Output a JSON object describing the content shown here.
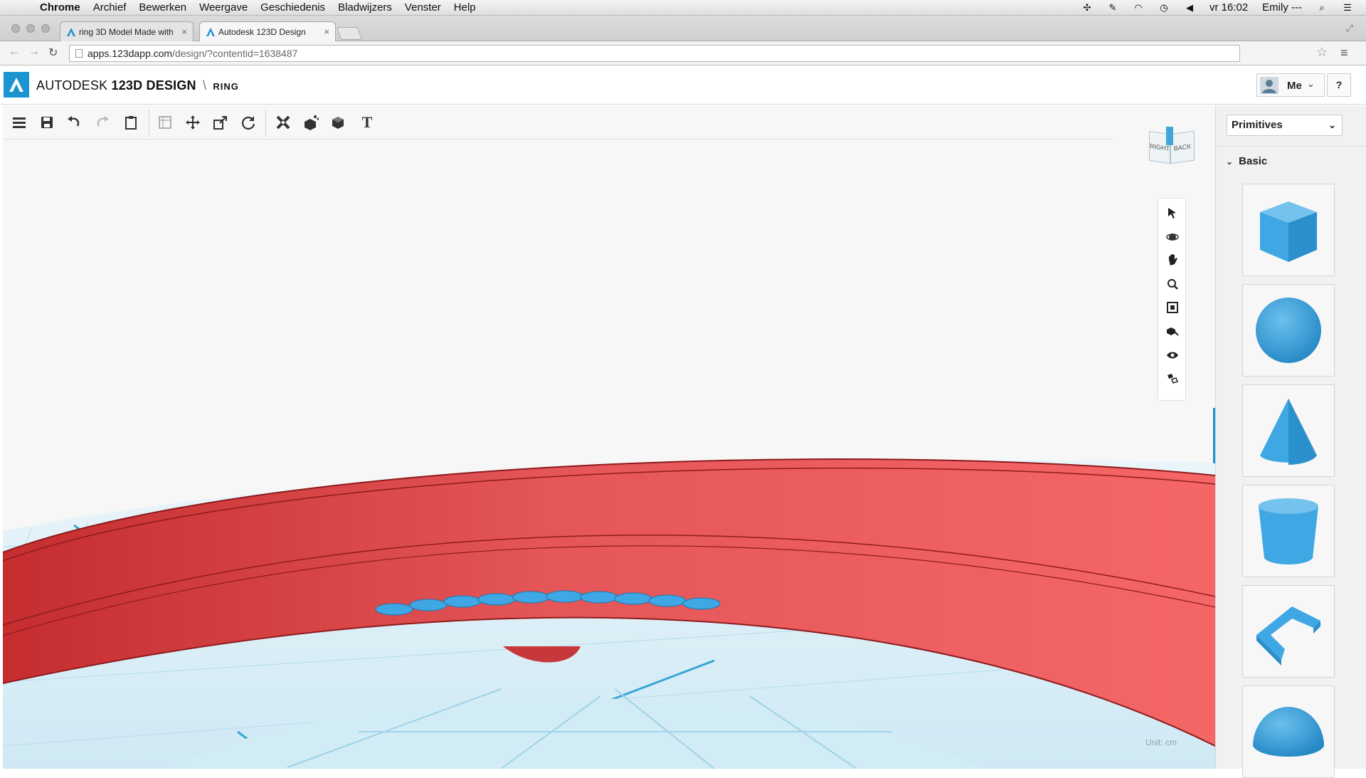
{
  "menubar": {
    "app": "Chrome",
    "items": [
      "Archief",
      "Bewerken",
      "Weergave",
      "Geschiedenis",
      "Bladwijzers",
      "Venster",
      "Help"
    ],
    "clock": "vr 16:02",
    "user": "Emily ---"
  },
  "browser": {
    "tabs": [
      {
        "title": "ring 3D Model Made with"
      },
      {
        "title": "Autodesk 123D Design"
      }
    ],
    "url_host": "apps.123dapp.com",
    "url_path": "/design/?contentid=1638487"
  },
  "app": {
    "brand_light": "AUTODESK",
    "brand_bold": "123D DESIGN",
    "separator": "\\",
    "project": "RING",
    "user_label": "Me",
    "help_label": "?"
  },
  "toolbar": {
    "tools": [
      "menu-icon",
      "save-icon",
      "undo-icon",
      "redo-icon",
      "clipboard-icon",
      "sketch-grid-icon",
      "move-icon",
      "scale-icon",
      "refresh-icon",
      "modify-tools-icon",
      "pattern-icon",
      "combine-icon",
      "text-icon"
    ],
    "text_tool_glyph": "T"
  },
  "viewcube": {
    "left_face": "RIGHT",
    "right_face": "BACK"
  },
  "nav_tools": [
    "select-arrow-icon",
    "orbit-icon",
    "pan-hand-icon",
    "zoom-icon",
    "fit-all-icon",
    "material-icon",
    "visibility-eye-icon",
    "snap-icon"
  ],
  "viewport": {
    "unit_label": "Unit:  cm"
  },
  "panel": {
    "dropdown_value": "Primitives",
    "section": "Basic",
    "shapes": [
      "box",
      "sphere",
      "cone",
      "cylinder",
      "polyline-wedge",
      "hemisphere"
    ]
  },
  "colors": {
    "accent": "#1a95d1",
    "model_red": "#e85a5a",
    "primitive_blue": "#3ea7e4",
    "grid_blue": "#bde0ef"
  }
}
